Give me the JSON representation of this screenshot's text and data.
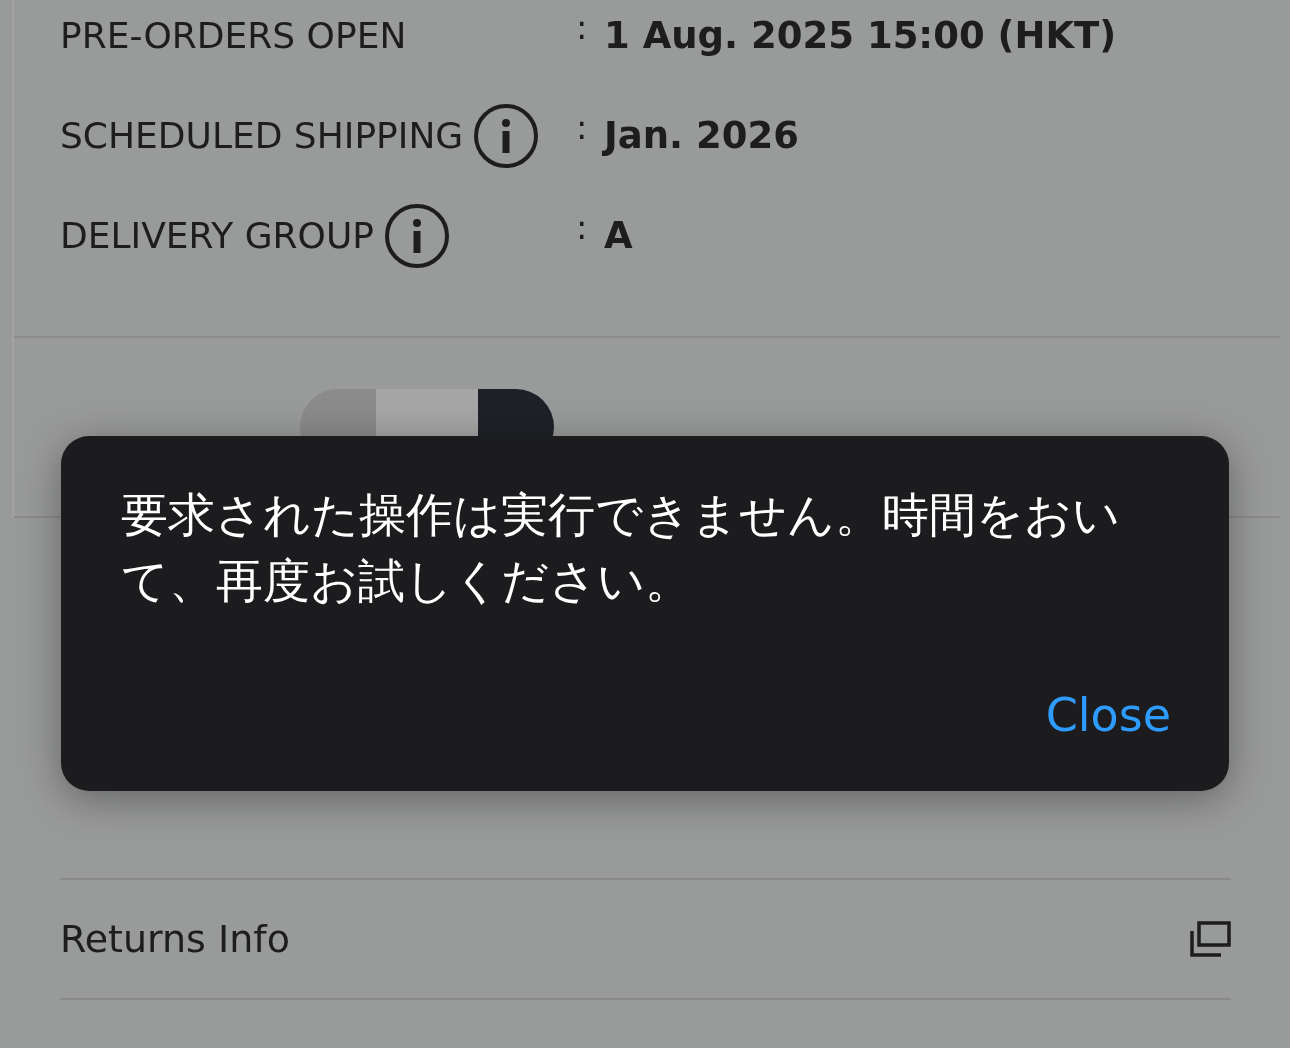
{
  "details": [
    {
      "label": "PRE-ORDERS OPEN",
      "info": false,
      "separator": ":",
      "value": "1 Aug. 2025 15:00 (HKT)"
    },
    {
      "label": "SCHEDULED SHIPPING",
      "info": true,
      "separator": ":",
      "value": "Jan. 2026"
    },
    {
      "label": "DELIVERY GROUP",
      "info": true,
      "separator": ":",
      "value": "A"
    }
  ],
  "links": [
    {
      "label": "Returns Info"
    }
  ],
  "dialog": {
    "message": "要求された操作は実行できません。時間をおいて、再度お試しください。",
    "button": "Close"
  }
}
